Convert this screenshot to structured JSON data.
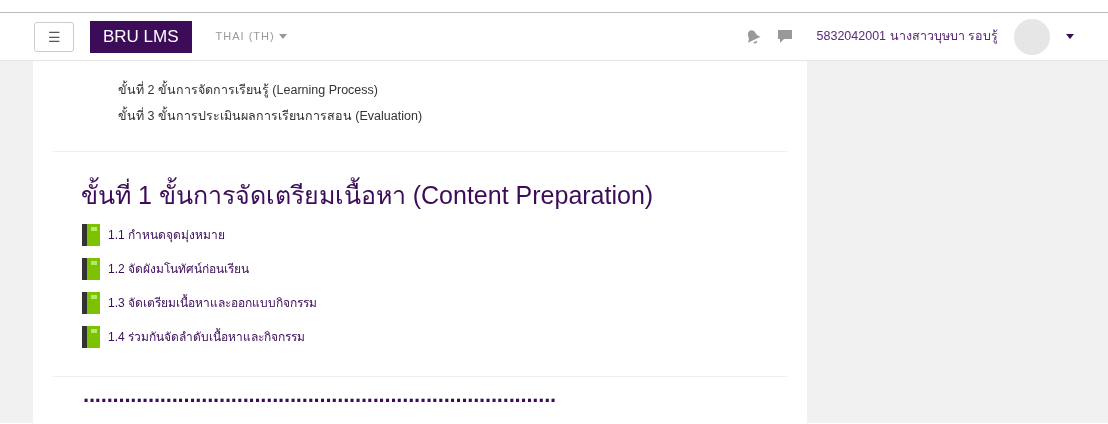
{
  "navbar": {
    "menu_button": "☰",
    "brand": "BRU LMS",
    "language": "THAI (TH)",
    "user_name": "5832042001 นางสาวบุษบา รอบรู้"
  },
  "outline": [
    "ขั้นที่ 2 ขั้นการจัดการเรียนรู้ (Learning Process)",
    "ขั้นที่ 3 ขั้นการประเมินผลการเรียนการสอน (Evaluation)"
  ],
  "section": {
    "title": "ขั้นที่ 1 ขั้นการจัดเตรียมเนื้อหา (Content Preparation)",
    "activities": [
      {
        "kind": "book",
        "name": "1.1 กำหนดจุดมุ่งหมาย"
      },
      {
        "kind": "book",
        "name": "1.2 จัดผังมโนทัศน์ก่อนเรียน"
      },
      {
        "kind": "book",
        "name": "1.3 จัดเตรียมเนื้อหาและออกแบบกิจกรรม"
      },
      {
        "kind": "book",
        "name": "1.4 ร่วมกันจัดลำดับเนื้อหาและกิจกรรม"
      }
    ]
  },
  "next_section_title": "................................................................................"
}
